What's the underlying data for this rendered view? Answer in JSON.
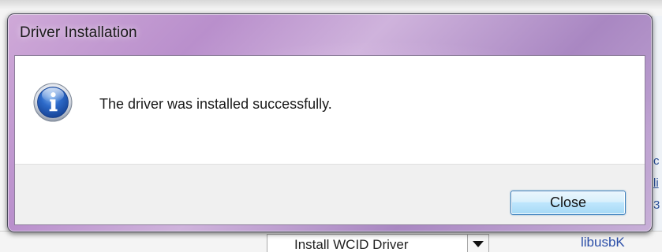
{
  "dialog": {
    "title": "Driver Installation",
    "message": "The driver was installed successfully.",
    "icon": "info-icon",
    "close_label": "Close"
  },
  "background": {
    "combo_value": "Install WCID Driver",
    "link_text": "libusbK",
    "right_glyphs": [
      "c",
      "li",
      "3"
    ]
  },
  "colors": {
    "title_bar_tint": "#c4a3d3",
    "button_border": "#3b7fbd",
    "info_icon_blue": "#1f56b5"
  }
}
